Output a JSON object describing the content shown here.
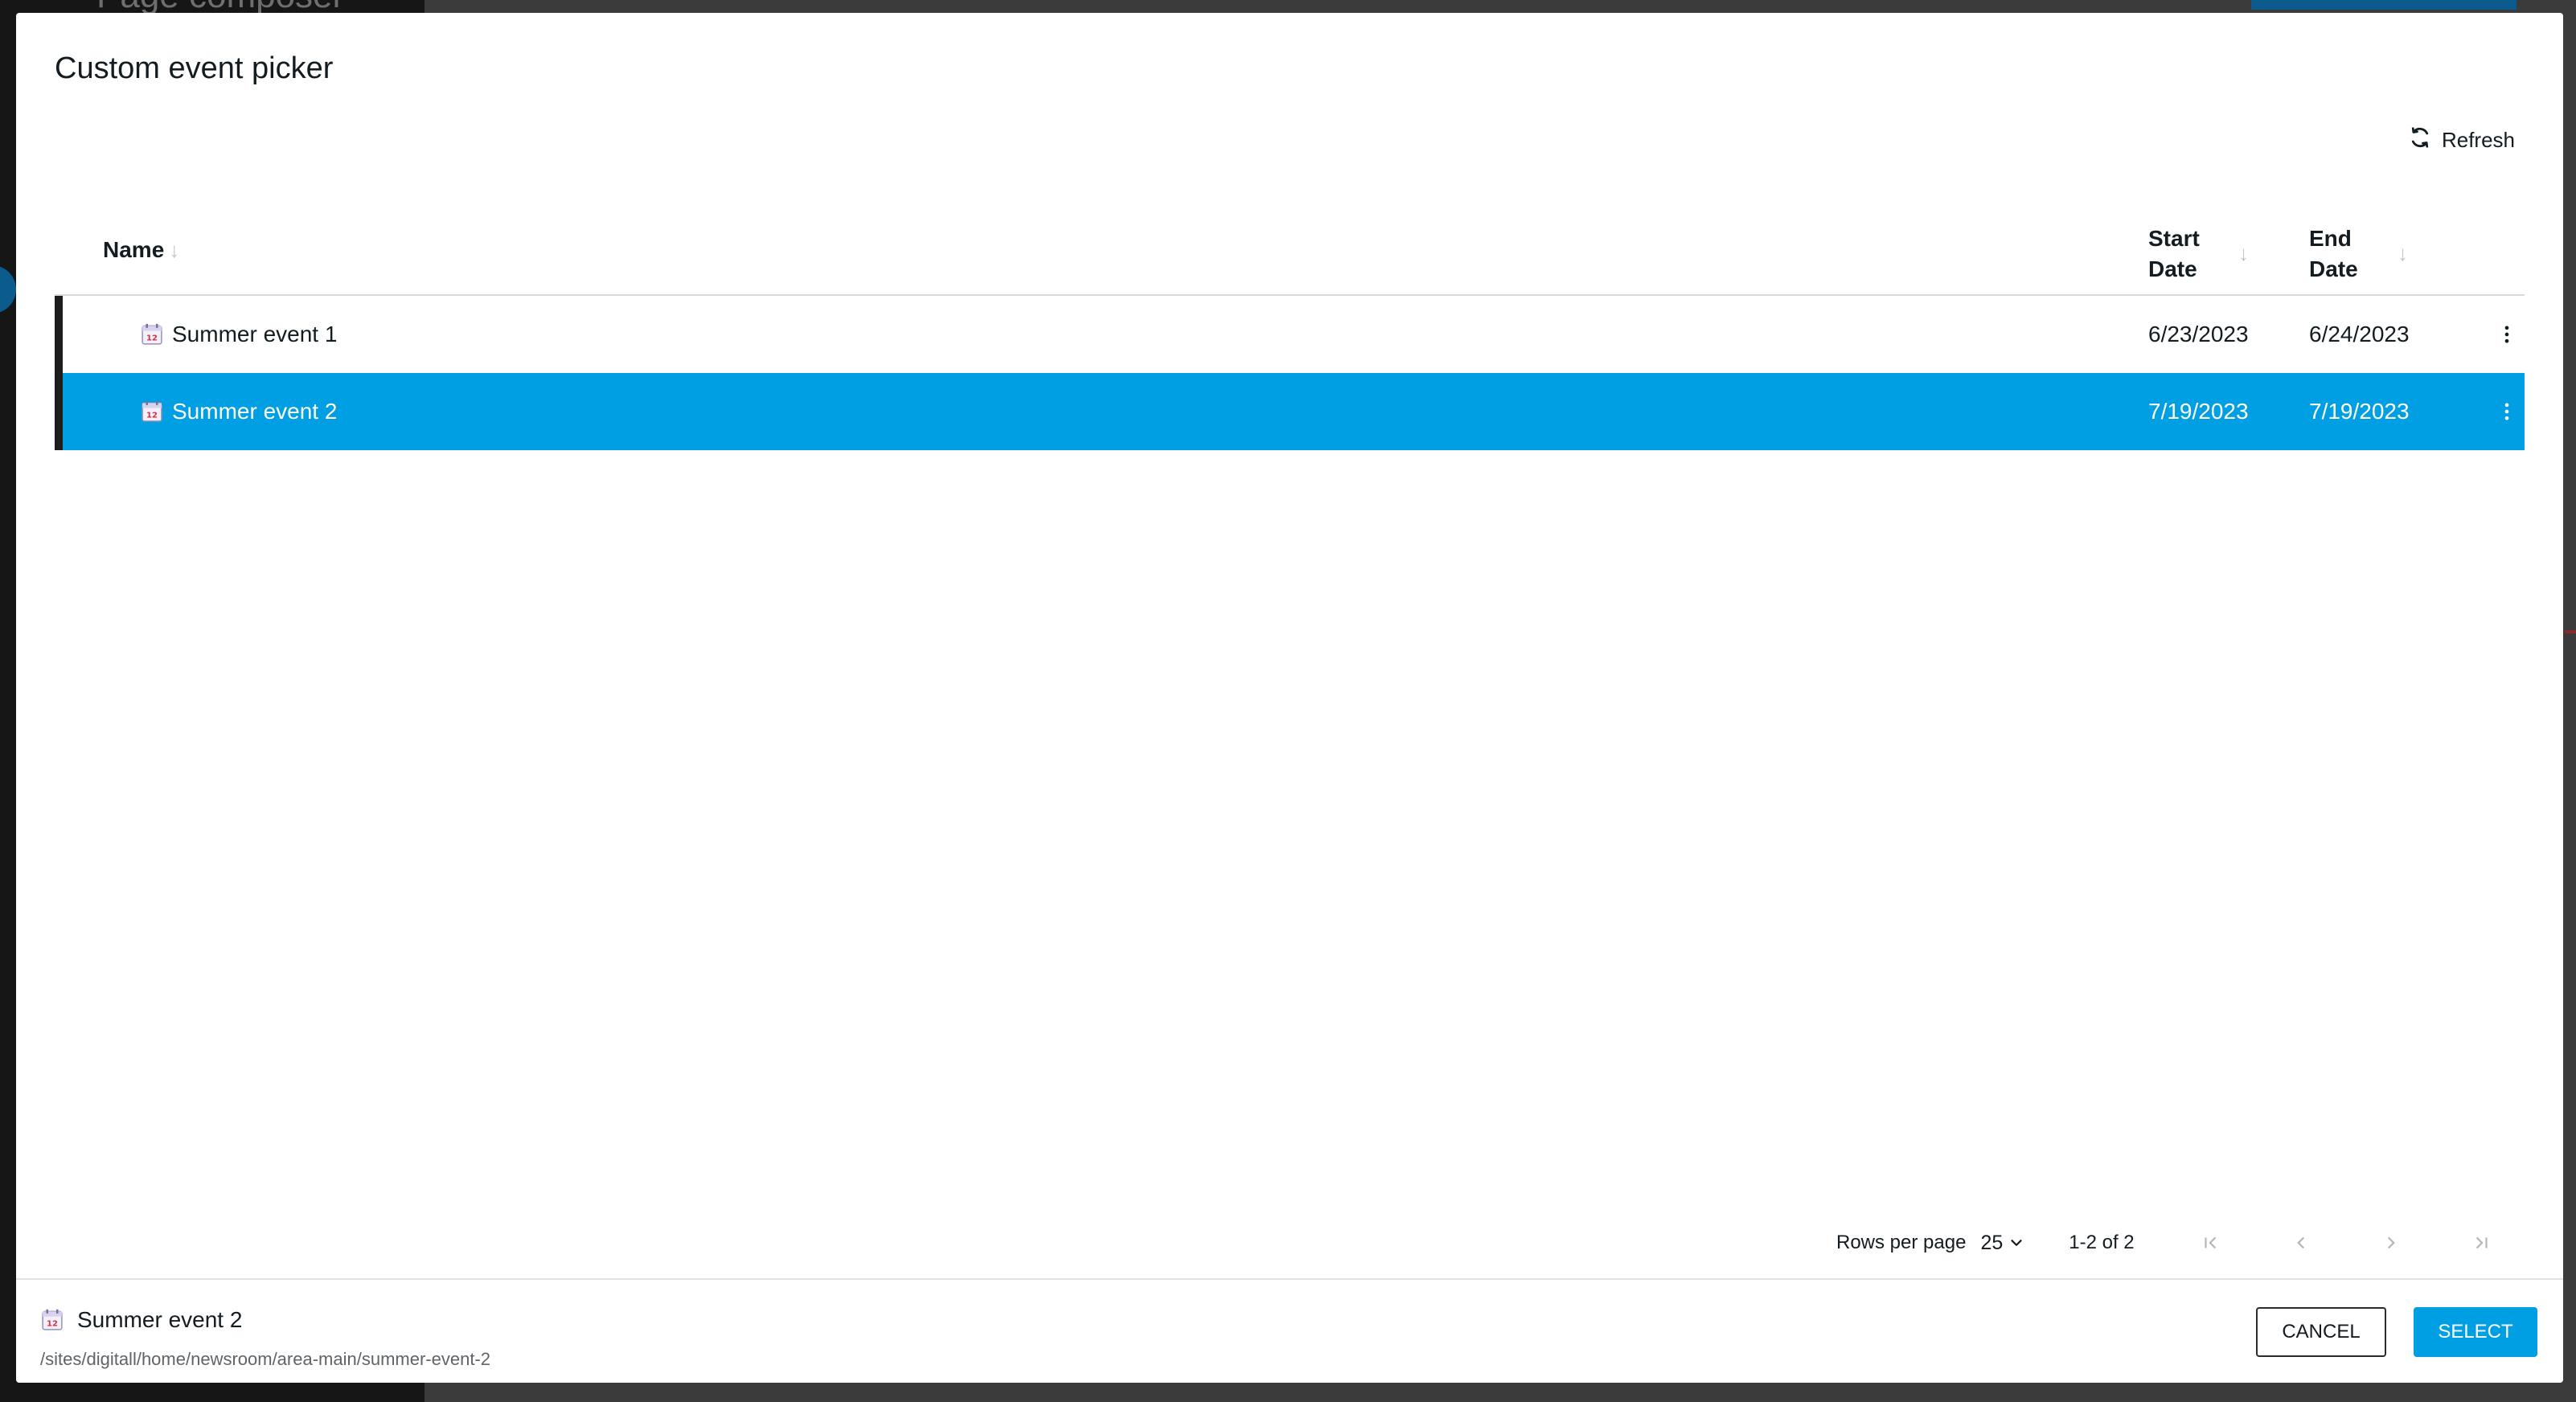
{
  "background": {
    "title": "Page composer"
  },
  "dialog": {
    "title": "Custom event picker",
    "refresh_label": "Refresh"
  },
  "table": {
    "columns": {
      "name": "Name",
      "start_date": "Start Date",
      "end_date": "End Date"
    },
    "rows": [
      {
        "name": "Summer event 1",
        "start_date": "6/23/2023",
        "end_date": "6/24/2023",
        "selected": false
      },
      {
        "name": "Summer event 2",
        "start_date": "7/19/2023",
        "end_date": "7/19/2023",
        "selected": true
      }
    ]
  },
  "pagination": {
    "rows_per_page_label": "Rows per page",
    "rows_per_page_value": "25",
    "range": "1-2 of 2"
  },
  "footer": {
    "selected_name": "Summer event 2",
    "selected_path": "/sites/digitall/home/newsroom/area-main/summer-event-2",
    "cancel_label": "CANCEL",
    "select_label": "SELECT"
  },
  "colors": {
    "accent": "#009fe3",
    "row_marker": "#1d1d1d"
  }
}
